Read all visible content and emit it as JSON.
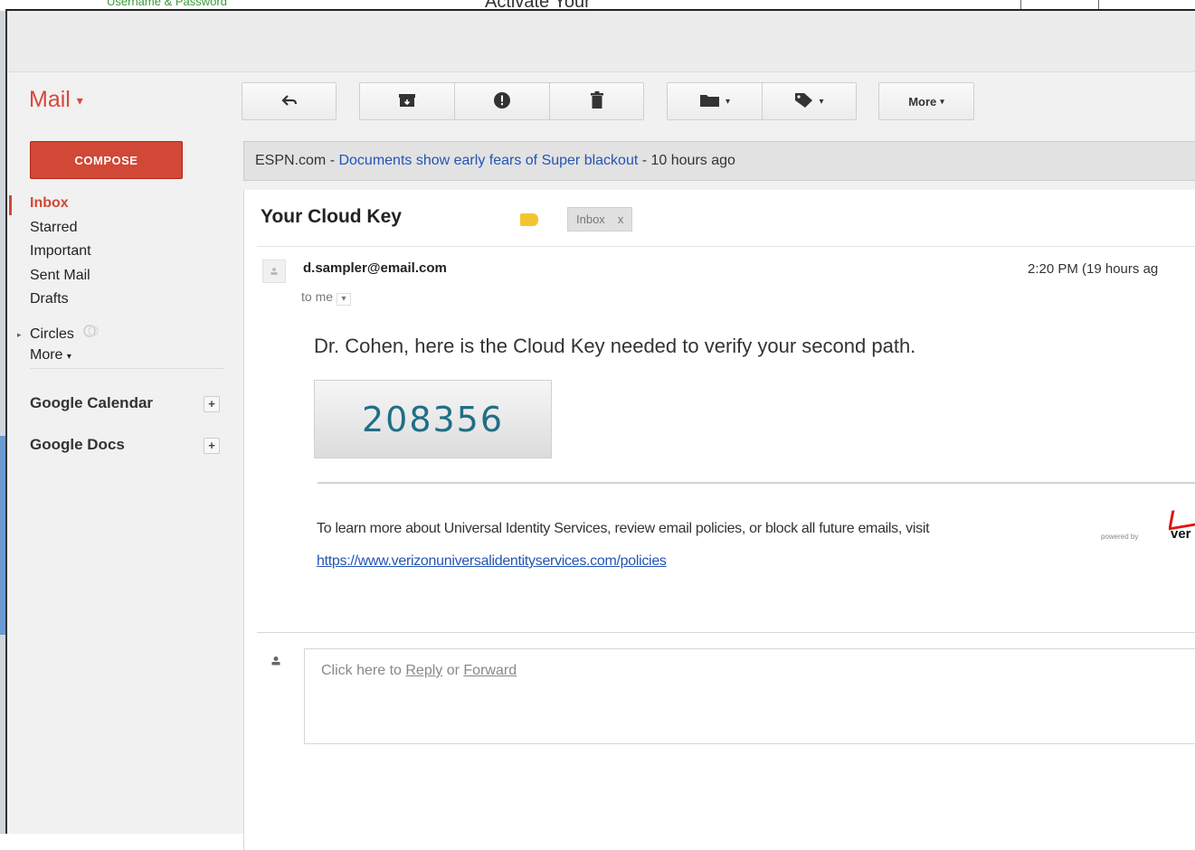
{
  "background_page": {
    "left_text": "Username & Password",
    "center_text": "Activate Your"
  },
  "app": {
    "title": "Mail",
    "title_caret": "▾"
  },
  "toolbar": {
    "reply_icon": "reply-icon",
    "archive_icon": "archive-icon",
    "spam_icon": "report-spam-icon",
    "delete_icon": "trash-icon",
    "move_icon": "folder-icon",
    "labels_icon": "label-tag-icon",
    "more_label": "More",
    "caret": "▾"
  },
  "compose": {
    "label": "COMPOSE",
    "color": "#d14836"
  },
  "sidebar": {
    "items": [
      {
        "label": "Inbox"
      },
      {
        "label": "Starred"
      },
      {
        "label": "Important"
      },
      {
        "label": "Sent Mail"
      },
      {
        "label": "Drafts"
      },
      {
        "label": "Circles"
      },
      {
        "label": "More"
      }
    ],
    "sections": [
      {
        "label": "Google Calendar",
        "action": "+"
      },
      {
        "label": "Google Docs",
        "action": "+"
      }
    ]
  },
  "web_clip": {
    "source": "ESPN.com",
    "separator": " - ",
    "headline": "Documents show early fears of Super blackout",
    "age": " - 10 hours ago"
  },
  "message": {
    "subject": "Your Cloud Key",
    "label_chip": "Inbox",
    "label_chip_close": "x",
    "sender": "d.sampler@email.com",
    "recipient": "to me",
    "time": "2:20 PM (19 hours ag",
    "body": "Dr. Cohen, here is the Cloud Key needed to verify your second path.",
    "cloud_key": "208356",
    "footer": "To learn more about Universal Identity Services, review email policies, or block all future emails, visit",
    "footer_link": "https://www.verizonuniversalidentityservices.com/policies",
    "powered_by": "powered by",
    "logo_text": "ver"
  },
  "reply": {
    "prefix": "Click here to ",
    "reply_word": "Reply",
    "or_word": " or ",
    "forward_word": "Forward"
  },
  "colors": {
    "accent_red": "#d14836",
    "link_blue": "#2354b4",
    "key_teal": "#1f6f86",
    "label_yellow": "#f4c430"
  }
}
